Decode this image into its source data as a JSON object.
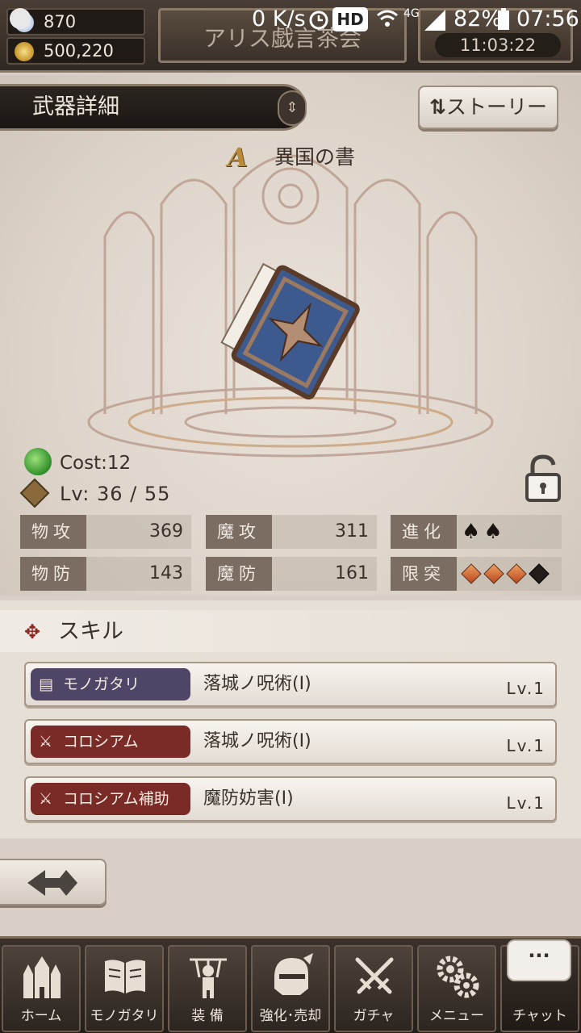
{
  "status_bar": {
    "speed": "0 K/s",
    "hd": "HD",
    "network": "4G",
    "battery": "82%",
    "time": "07:56"
  },
  "top": {
    "crystals": "870",
    "gold": "500,220",
    "title": "アリス戯言茶会",
    "timer": "11:03:22"
  },
  "header": {
    "title": "武器詳細",
    "story_button": "ストーリー"
  },
  "weapon": {
    "rank": "A",
    "name": "異国の書",
    "cost": "Cost:12",
    "level": "Lv: 36 / 55",
    "stats": {
      "phys_atk_label": "物攻",
      "phys_atk": "369",
      "mag_atk_label": "魔攻",
      "mag_atk": "311",
      "evolve_label": "進化",
      "phys_def_label": "物防",
      "phys_def": "143",
      "mag_def_label": "魔防",
      "mag_def": "161",
      "limit_label": "限突"
    },
    "evolve_count": 2,
    "limit_break": {
      "filled": 3,
      "total": 4
    }
  },
  "skills": {
    "heading": "スキル",
    "items": [
      {
        "tag": "モノガタリ",
        "name": "落城ノ呪術(Ⅰ)",
        "level": "Lv.1"
      },
      {
        "tag": "コロシアム",
        "name": "落城ノ呪術(Ⅰ)",
        "level": "Lv.1"
      },
      {
        "tag": "コロシアム補助",
        "name": "魔防妨害(Ⅰ)",
        "level": "Lv.1"
      }
    ]
  },
  "nav": {
    "home": "ホーム",
    "story": "モノガタリ",
    "equip": "装 備",
    "enhance": "強化･売却",
    "gacha": "ガチャ",
    "menu": "メニュー",
    "chat": "チャット",
    "chat_bubble": "···"
  },
  "colors": {
    "tag_purple": "#4f4567",
    "tag_red": "#7a2b27",
    "stat_label_bg": "#7b6d62",
    "limit_diamond": "#d9703a"
  }
}
